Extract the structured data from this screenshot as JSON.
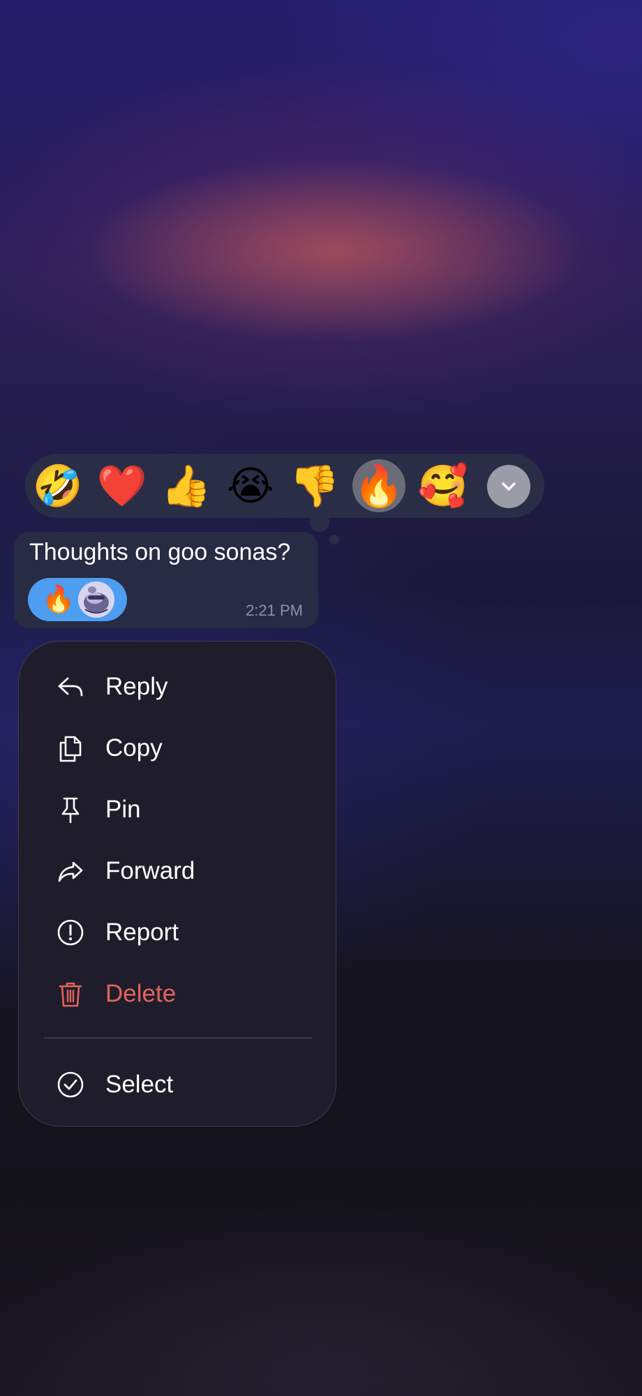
{
  "reactions": {
    "emojis": [
      {
        "glyph": "🤣",
        "name": "rolling-laughing"
      },
      {
        "glyph": "❤️",
        "name": "heart"
      },
      {
        "glyph": "👍",
        "name": "thumbs-up"
      },
      {
        "glyph": "😭",
        "name": "crying"
      },
      {
        "glyph": "👎",
        "name": "thumbs-down"
      },
      {
        "glyph": "🔥",
        "name": "fire",
        "selected": true
      },
      {
        "glyph": "🥰",
        "name": "smiling-hearts"
      }
    ],
    "expand_icon": "chevron-down-icon"
  },
  "message": {
    "text": "Thoughts on goo sonas?",
    "reaction_emoji": "🔥",
    "time": "2:21 PM"
  },
  "menu": {
    "reply": "Reply",
    "copy": "Copy",
    "pin": "Pin",
    "forward": "Forward",
    "report": "Report",
    "delete": "Delete",
    "select": "Select"
  },
  "colors": {
    "accent_blue": "#4d9df0",
    "delete_red": "#e2645b",
    "bubble_bg": "#272b43",
    "menu_bg": "#1f1d2b"
  }
}
